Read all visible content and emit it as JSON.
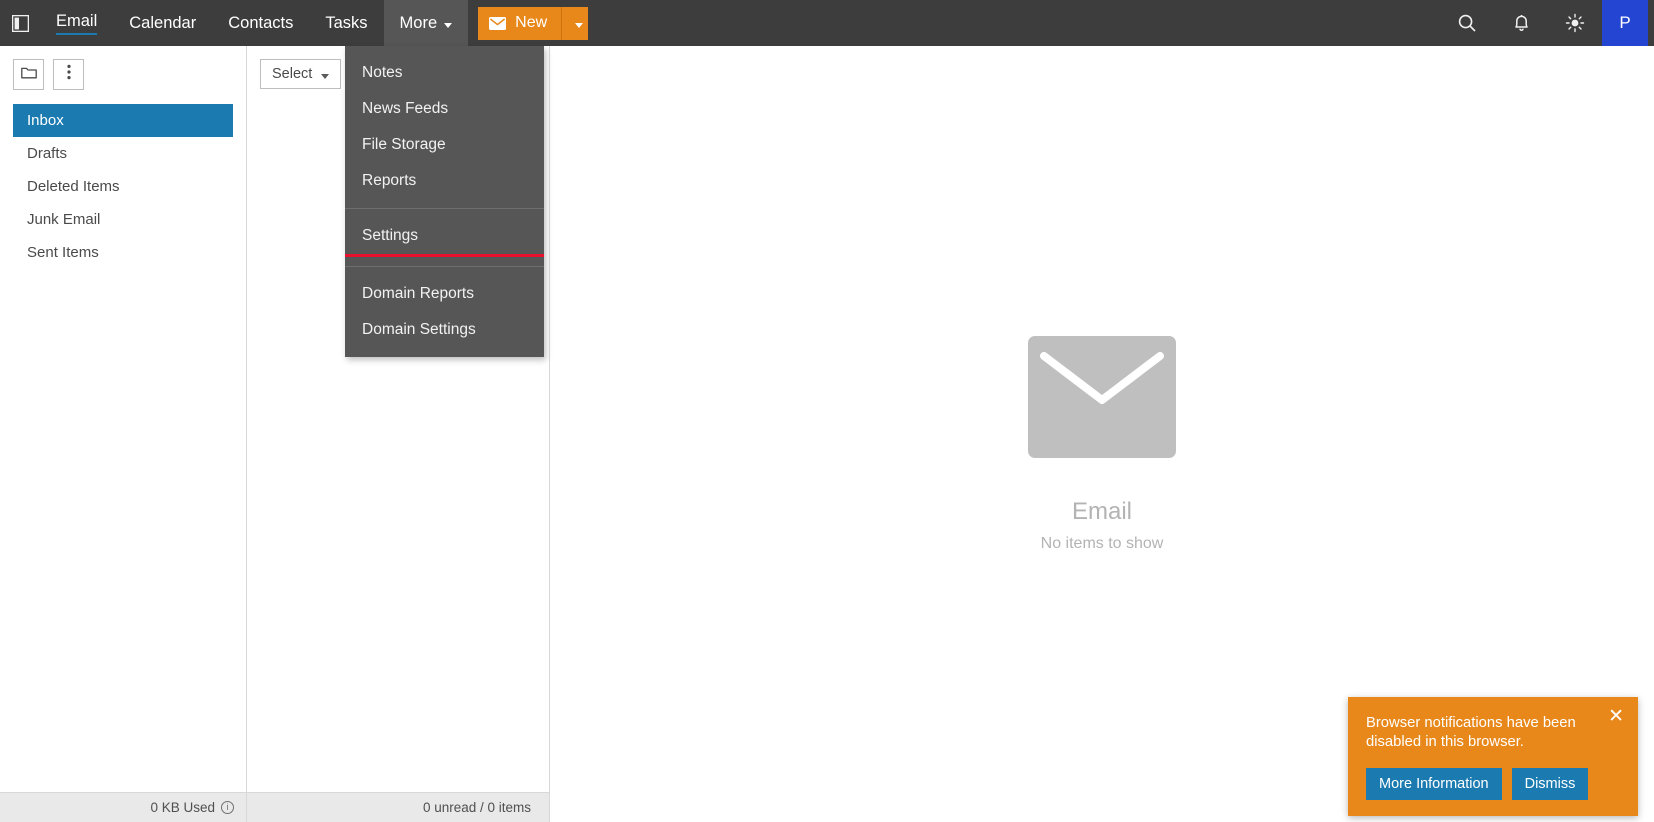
{
  "topbar": {
    "panel_toggle_icon": "sidebar-toggle-icon",
    "nav": [
      {
        "label": "Email",
        "active": true,
        "has_caret": false
      },
      {
        "label": "Calendar",
        "active": false,
        "has_caret": false
      },
      {
        "label": "Contacts",
        "active": false,
        "has_caret": false
      },
      {
        "label": "Tasks",
        "active": false,
        "has_caret": false
      },
      {
        "label": "More",
        "active": false,
        "has_caret": true
      }
    ],
    "new_button": {
      "label": "New",
      "icon": "envelope-icon",
      "split_icon": "chevron-down-icon",
      "color": "#e8881a"
    },
    "icons": [
      {
        "name": "search-icon"
      },
      {
        "name": "bell-icon"
      },
      {
        "name": "brightness-icon"
      }
    ],
    "avatar": {
      "initial": "P",
      "color": "#2445d2"
    },
    "background": "#3d3d3d"
  },
  "more_menu": {
    "groups": [
      {
        "items": [
          "Notes",
          "News Feeds",
          "File Storage",
          "Reports"
        ]
      },
      {
        "items": [
          "Settings"
        ]
      },
      {
        "items": [
          "Domain Reports",
          "Domain Settings"
        ]
      }
    ],
    "highlighted_item": "Settings",
    "highlight_color": "#e8112d",
    "background": "#565656"
  },
  "folder_pane": {
    "toolbar": [
      {
        "name": "new-folder-button",
        "icon": "folder-icon"
      },
      {
        "name": "folder-actions-button",
        "icon": "kebab-menu-icon"
      }
    ],
    "folders": [
      {
        "label": "Inbox",
        "selected": true
      },
      {
        "label": "Drafts",
        "selected": false
      },
      {
        "label": "Deleted Items",
        "selected": false
      },
      {
        "label": "Junk Email",
        "selected": false
      },
      {
        "label": "Sent Items",
        "selected": false
      }
    ],
    "selected_color": "#1b7bb0",
    "status": {
      "text": "0 KB Used",
      "info_icon": "info-icon"
    }
  },
  "list_pane": {
    "select_button": {
      "label": "Select",
      "icon": "chevron-down-icon"
    },
    "status": {
      "text": "0 unread / 0 items"
    }
  },
  "reading_pane": {
    "empty_state": {
      "icon": "envelope-icon",
      "title": "Email",
      "subtitle": "No items to show"
    }
  },
  "toast": {
    "message": "Browser notifications have been disabled in this browser.",
    "close_icon": "close-icon",
    "background": "#e8881a",
    "buttons": [
      {
        "label": "More Information",
        "name": "more-information-button"
      },
      {
        "label": "Dismiss",
        "name": "dismiss-button"
      }
    ],
    "button_color": "#1b7bb0"
  }
}
